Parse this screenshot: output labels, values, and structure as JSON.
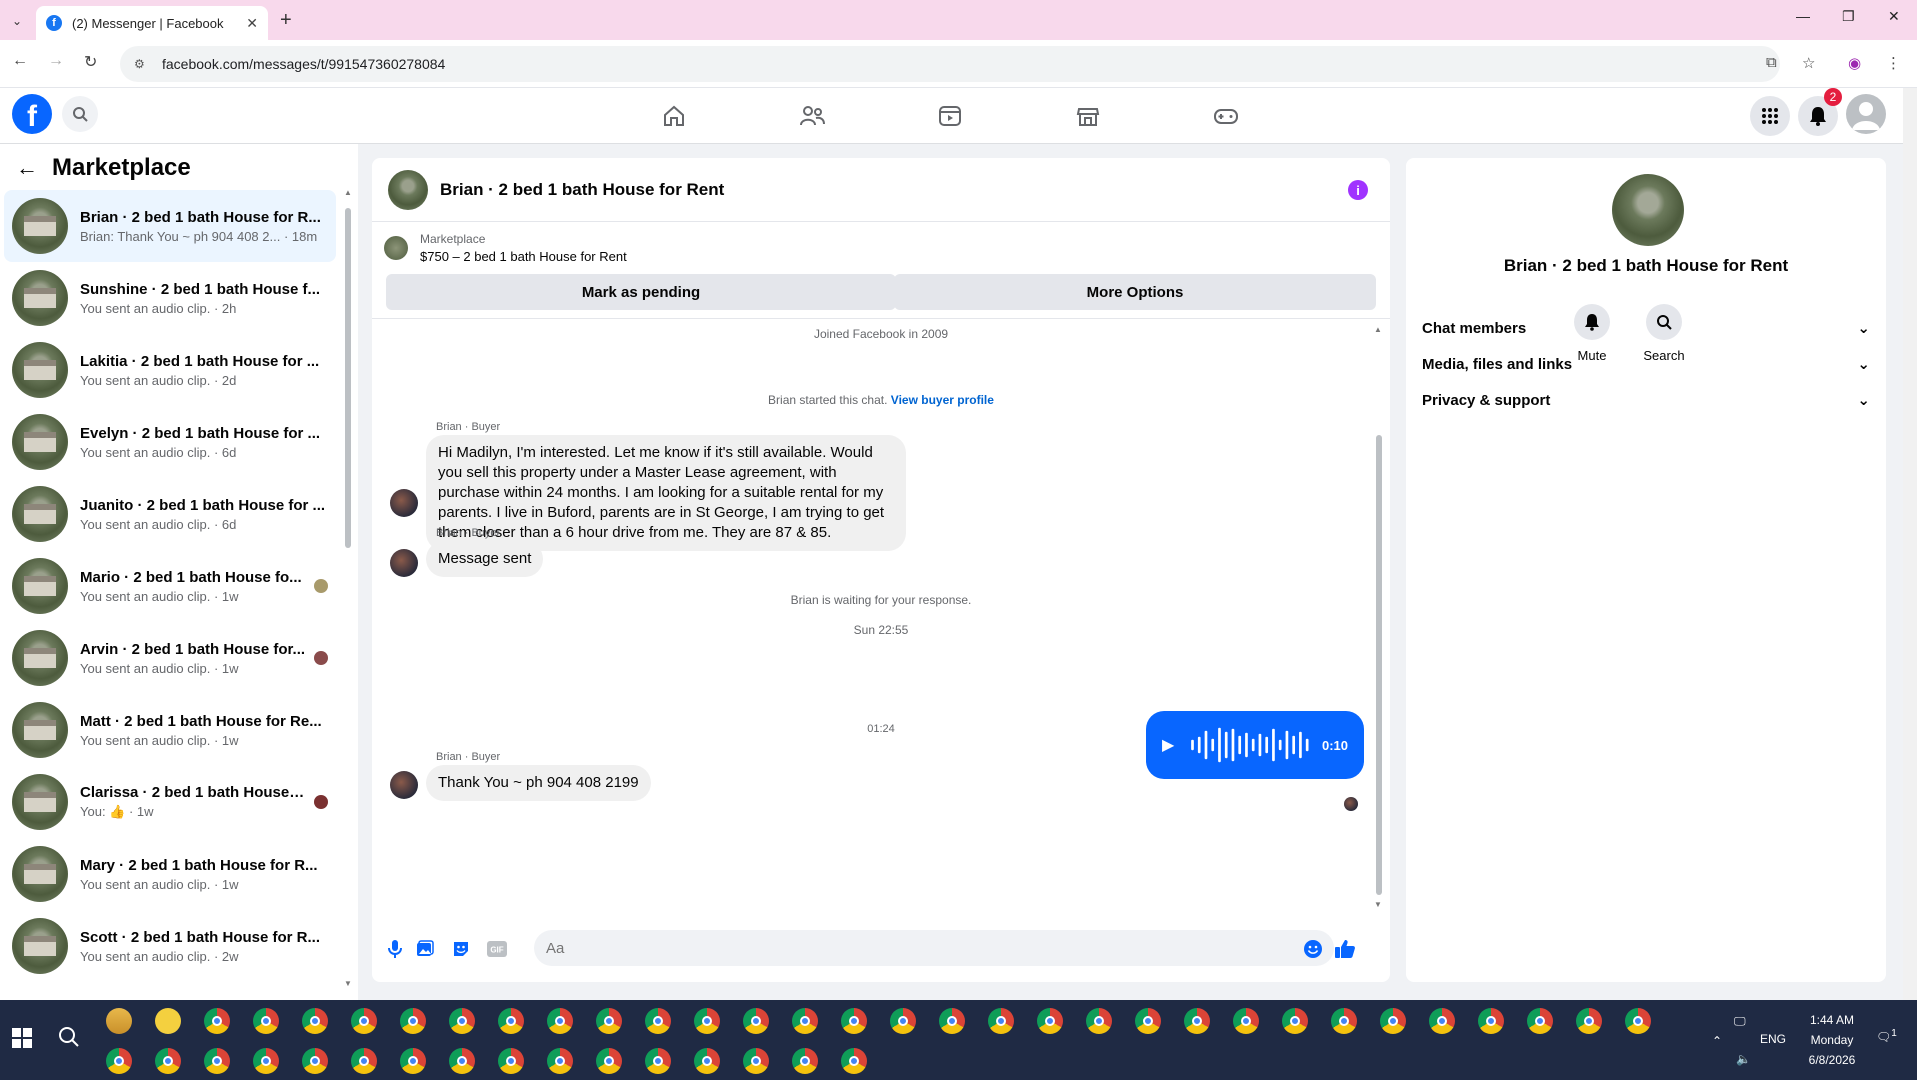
{
  "browser": {
    "tab_title": "(2) Messenger | Facebook",
    "url": "facebook.com/messages/t/991547360278084"
  },
  "fbnav": {
    "notification_count": "2"
  },
  "left_pane": {
    "title": "Marketplace",
    "conversations": [
      {
        "name": "Brian · 2 bed 1 bath House for R...",
        "preview": "Brian: Thank You ~ ph 904 408 2... · 18m",
        "active": true
      },
      {
        "name": "Sunshine · 2 bed 1 bath House f...",
        "preview": "You sent an audio clip. · 2h"
      },
      {
        "name": "Lakitia · 2 bed 1 bath House for ...",
        "preview": "You sent an audio clip. · 2d"
      },
      {
        "name": "Evelyn · 2 bed 1 bath House for ...",
        "preview": "You sent an audio clip. · 6d"
      },
      {
        "name": "Juanito · 2 bed 1 bath House for ...",
        "preview": "You sent an audio clip. · 6d"
      },
      {
        "name": "Mario · 2 bed 1 bath House fo...",
        "preview": "You sent an audio clip. · 1w"
      },
      {
        "name": "Arvin · 2 bed 1 bath House for...",
        "preview": "You sent an audio clip. · 1w"
      },
      {
        "name": "Matt · 2 bed 1 bath House for Re...",
        "preview": "You sent an audio clip. · 1w"
      },
      {
        "name": "Clarissa · 2 bed 1 bath House f...",
        "preview": "You: 👍 · 1w"
      },
      {
        "name": "Mary · 2 bed 1 bath House for R...",
        "preview": "You sent an audio clip. · 1w"
      },
      {
        "name": "Scott · 2 bed 1 bath House for R...",
        "preview": "You sent an audio clip. · 2w"
      }
    ]
  },
  "chat": {
    "title": "Brian · 2 bed 1 bath House for Rent",
    "marketplace_label": "Marketplace",
    "listing": "$750 – 2 bed 1 bath House for Rent",
    "mark_pending": "Mark as pending",
    "more_options": "More Options",
    "joined": "Joined Facebook in 2009",
    "started_text": "Brian started this chat.",
    "view_profile": "View buyer profile",
    "sender_label": "Brian · Buyer",
    "msg1": "Hi Madilyn, I'm interested. Let me know if it's still available. Would you sell this property under a Master Lease agreement, with purchase within 24 months. I am looking for a suitable rental for my parents. I live in Buford, parents are in St George, I am trying to get them closer than a 6 hour drive from me. They are 87 & 85.",
    "msg2": "Message sent",
    "waiting": "Brian is waiting for your response.",
    "time1": "Sun 22:55",
    "audio_duration": "0:10",
    "time2": "01:24",
    "msg3": "Thank You ~ ph 904 408 2199",
    "composer_placeholder": "Aa"
  },
  "info_pane": {
    "name": "Brian · 2 bed 1 bath House for Rent",
    "mute": "Mute",
    "search": "Search",
    "sections": [
      "Chat members",
      "Media, files and links",
      "Privacy & support"
    ]
  },
  "taskbar": {
    "lang": "ENG",
    "time": "1:44 AM",
    "day": "Monday",
    "date": "6/8/2026",
    "notif": "1"
  }
}
